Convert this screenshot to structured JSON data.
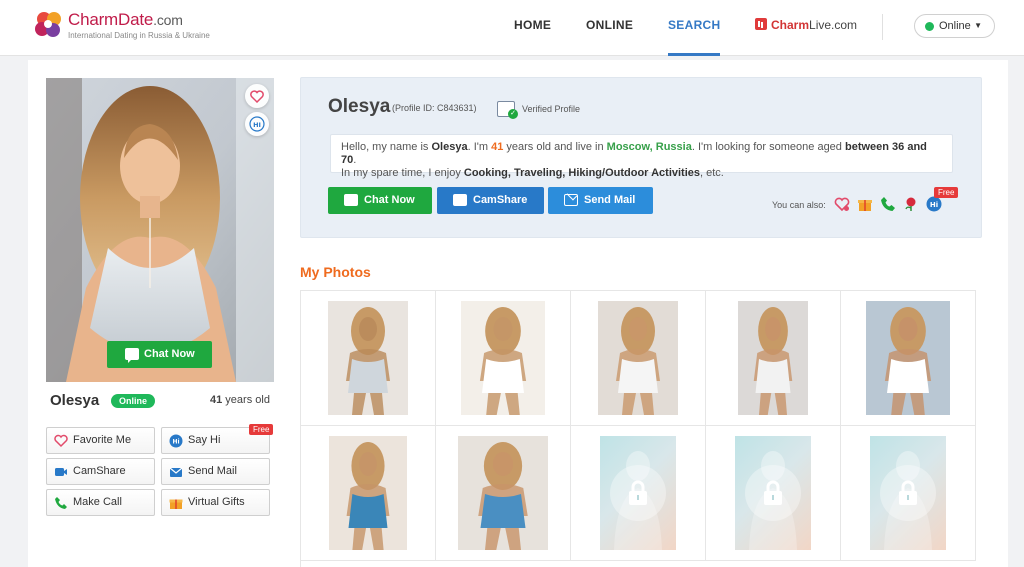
{
  "brand": {
    "name_main": "Charm",
    "name_accent": "Date",
    "name_tld": ".com",
    "tagline": "International Dating in Russia & Ukraine"
  },
  "nav": {
    "home": "HOME",
    "online": "ONLINE",
    "search": "SEARCH",
    "live_a": "Charm",
    "live_b": "Live",
    "live_c": ".com",
    "active": "SEARCH"
  },
  "status": {
    "label": "Online",
    "color": "#1fb85a"
  },
  "profile": {
    "name": "Olesya",
    "id_text": "(Profile ID: C843631)",
    "verified": "Verified Profile",
    "status_badge": "Online",
    "age_num": "41",
    "age_suffix": " years old",
    "intro": {
      "p1": "Hello, my name is ",
      "name": "Olesya",
      "p2": ". I'm ",
      "age": "41",
      "p3": " years old and live in ",
      "place": "Moscow, Russia",
      "p4": ". I'm looking for someone aged ",
      "range": "between 36 and 70",
      "p5": ".",
      "p6": "In my spare time, I enjoy ",
      "hobbies": "Cooking, Traveling, Hiking/Outdoor Activities",
      "p7": ", etc."
    }
  },
  "actions": {
    "chat_now": "Chat Now",
    "camshare": "CamShare",
    "send_mail": "Send Mail",
    "you_can_also": "You can also:",
    "free": "Free"
  },
  "left_actions": {
    "favorite": "Favorite Me",
    "say_hi": "Say Hi",
    "camshare": "CamShare",
    "send_mail": "Send Mail",
    "make_call": "Make Call",
    "virtual_gifts": "Virtual Gifts",
    "free": "Free"
  },
  "hero": {
    "chat_now": "Chat Now",
    "hi": "HI"
  },
  "photos": {
    "title": "My Photos",
    "items": [
      {
        "type": "photo",
        "palette": [
          "#e9e4df",
          "#b98a5a",
          "#cfd6dc"
        ]
      },
      {
        "type": "photo",
        "palette": [
          "#f3efe9",
          "#c49567",
          "#ffffff"
        ]
      },
      {
        "type": "photo",
        "palette": [
          "#e2dcd6",
          "#c9976a",
          "#f5f5f5"
        ]
      },
      {
        "type": "photo",
        "palette": [
          "#dcd9d7",
          "#c8936a",
          "#f2f2f2"
        ]
      },
      {
        "type": "photo",
        "palette": [
          "#b9c7d3",
          "#c5916a",
          "#ffffff"
        ]
      },
      {
        "type": "photo",
        "palette": [
          "#ece4dc",
          "#c69468",
          "#3a86b8"
        ]
      },
      {
        "type": "photo",
        "palette": [
          "#e7e2dc",
          "#c89469",
          "#4a8fc2"
        ]
      },
      {
        "type": "locked"
      },
      {
        "type": "locked"
      },
      {
        "type": "locked"
      }
    ]
  },
  "colors": {
    "brand_red": "#c01c4a",
    "nav_active": "#3579c5",
    "green": "#1fa83f",
    "blue": "#2879c8",
    "orange": "#ef6b1f"
  }
}
